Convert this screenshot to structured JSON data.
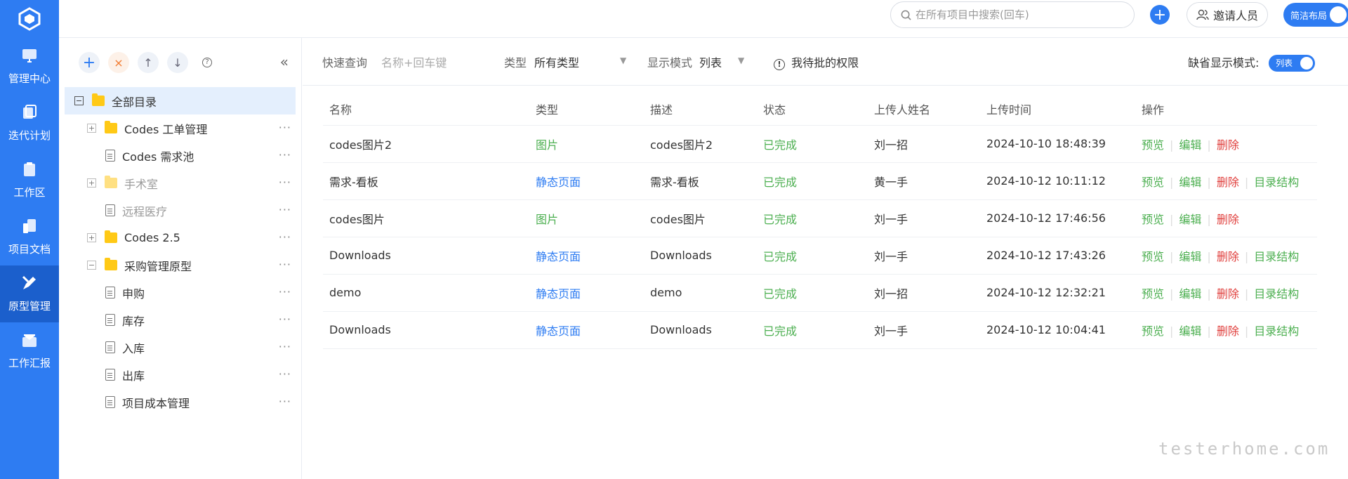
{
  "nav": {
    "items": [
      {
        "label": "管理中心",
        "icon": "monitor-icon"
      },
      {
        "label": "迭代计划",
        "icon": "iteration-icon"
      },
      {
        "label": "工作区",
        "icon": "clipboard-icon"
      },
      {
        "label": "项目文档",
        "icon": "docs-icon"
      },
      {
        "label": "原型管理",
        "icon": "prototype-icon"
      },
      {
        "label": "工作汇报",
        "icon": "mail-icon"
      }
    ]
  },
  "header": {
    "search_placeholder": "在所有项目中搜索(回车)",
    "add_label": "+",
    "invite_label": "邀请人员",
    "layout_label": "简洁布局"
  },
  "tree": {
    "tools": {
      "add": "+",
      "delete": "×",
      "up": "↑",
      "down": "↓",
      "help": "?",
      "collapse": "«"
    },
    "more": "···",
    "root": {
      "label": "全部目录",
      "expander": "−"
    },
    "items": [
      {
        "label": "Codes 工单管理",
        "kind": "folder",
        "expander": "+"
      },
      {
        "label": "Codes 需求池",
        "kind": "doc"
      },
      {
        "label": "手术室",
        "kind": "folder",
        "expander": "+"
      },
      {
        "label": "远程医疗",
        "kind": "doc"
      },
      {
        "label": "Codes 2.5",
        "kind": "folder",
        "expander": "+"
      },
      {
        "label": "采购管理原型",
        "kind": "folder",
        "expander": "−"
      },
      {
        "label": "申购",
        "kind": "doc"
      },
      {
        "label": "库存",
        "kind": "doc"
      },
      {
        "label": "入库",
        "kind": "doc"
      },
      {
        "label": "出库",
        "kind": "doc"
      },
      {
        "label": "项目成本管理",
        "kind": "doc"
      }
    ]
  },
  "filter": {
    "quick_label": "快速查询",
    "quick_placeholder": "名称+回车键",
    "type_label": "类型",
    "type_value": "所有类型",
    "mode_label": "显示模式",
    "mode_value": "列表",
    "pending_label": "我待批的权限",
    "default_mode_label": "缺省显示模式:",
    "default_mode_value": "列表"
  },
  "table": {
    "headers": [
      "名称",
      "类型",
      "描述",
      "状态",
      "上传人姓名",
      "上传时间",
      "操作"
    ],
    "ops": {
      "preview": "预览",
      "edit": "编辑",
      "delete": "删除",
      "structure": "目录结构"
    },
    "rows": [
      {
        "name": "codes图片2",
        "type": "图片",
        "desc": "codes图片2",
        "status": "已完成",
        "uploader": "刘一招",
        "time": "2024-10-10 18:48:39",
        "structure": false
      },
      {
        "name": "需求-看板",
        "type": "静态页面",
        "desc": "需求-看板",
        "status": "已完成",
        "uploader": "黄一手",
        "time": "2024-10-12 10:11:12",
        "structure": true
      },
      {
        "name": "codes图片",
        "type": "图片",
        "desc": "codes图片",
        "status": "已完成",
        "uploader": "刘一手",
        "time": "2024-10-12 17:46:56",
        "structure": false
      },
      {
        "name": "Downloads",
        "type": "静态页面",
        "desc": "Downloads",
        "status": "已完成",
        "uploader": "刘一手",
        "time": "2024-10-12 17:43:26",
        "structure": true
      },
      {
        "name": "demo",
        "type": "静态页面",
        "desc": "demo",
        "status": "已完成",
        "uploader": "刘一招",
        "time": "2024-10-12 12:32:21",
        "structure": true
      },
      {
        "name": "Downloads",
        "type": "静态页面",
        "desc": "Downloads",
        "status": "已完成",
        "uploader": "刘一手",
        "time": "2024-10-12 10:04:41",
        "structure": true
      }
    ]
  },
  "watermark": "testerhome.com",
  "colors": {
    "primary": "#2e7cf2",
    "success": "#4caf50",
    "danger": "#e0403e",
    "folder": "#ffc916"
  }
}
